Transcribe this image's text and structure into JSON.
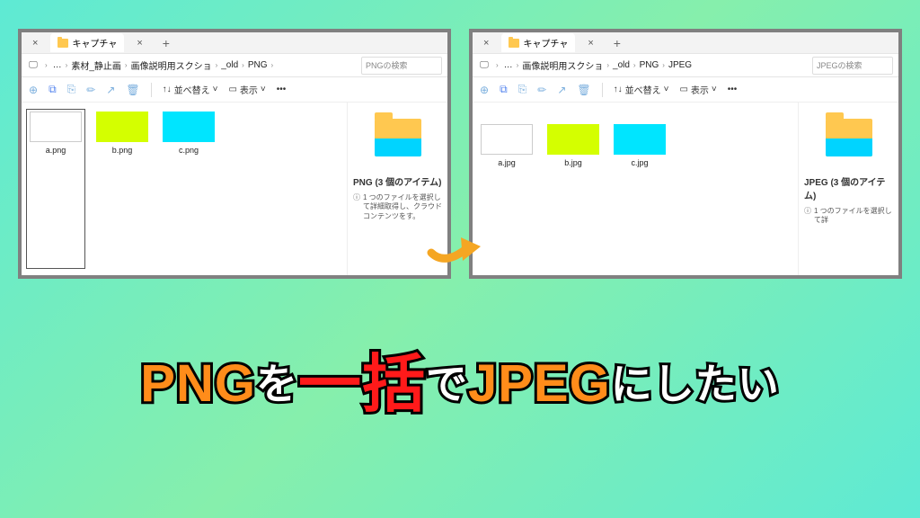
{
  "left": {
    "tabTitle": "キャプチャ",
    "breadcrumb": [
      "…",
      "素材_静止画",
      "画像説明用スクショ",
      "_old",
      "PNG"
    ],
    "searchPlaceholder": "PNGの検索",
    "sortLabel": "並べ替え",
    "viewLabel": "表示",
    "files": [
      {
        "name": "a.png",
        "color": "white",
        "selected": true
      },
      {
        "name": "b.png",
        "color": "lime",
        "selected": false
      },
      {
        "name": "c.png",
        "color": "cyan",
        "selected": false
      }
    ],
    "panelTitle": "PNG (3 個のアイテム)",
    "panelDesc": "1 つのファイルを選択して詳細取得し、クラウド コンテンツをす。"
  },
  "right": {
    "tabTitle": "キャプチャ",
    "breadcrumb": [
      "…",
      "画像説明用スクショ",
      "_old",
      "PNG",
      "JPEG"
    ],
    "searchPlaceholder": "JPEGの検索",
    "sortLabel": "並べ替え",
    "viewLabel": "表示",
    "files": [
      {
        "name": "a.jpg",
        "color": "white",
        "selected": false
      },
      {
        "name": "b.jpg",
        "color": "lime",
        "selected": false
      },
      {
        "name": "c.jpg",
        "color": "cyan",
        "selected": false
      }
    ],
    "panelTitle": "JPEG (3 個のアイテム)",
    "panelDesc": "1 つのファイルを選択して詳"
  },
  "headline": {
    "p1": "PNG",
    "p2": "を",
    "p3": "一括",
    "p4": "で",
    "p5": "JPEG",
    "p6": "にしたい"
  }
}
